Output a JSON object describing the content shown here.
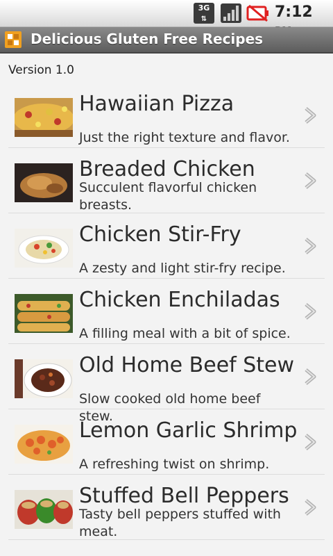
{
  "status": {
    "network": "3G",
    "time": "7:12",
    "ampm": "PM"
  },
  "app": {
    "title": "Delicious Gluten Free Recipes",
    "version": "Version 1.0"
  },
  "recipes": [
    {
      "title": "Hawaiian Pizza",
      "desc": "Just the right texture and flavor.",
      "lines": 1
    },
    {
      "title": "Breaded Chicken",
      "desc": "Succulent flavorful chicken breasts.",
      "lines": 2
    },
    {
      "title": "Chicken Stir-Fry",
      "desc": "A zesty and light stir-fry recipe.",
      "lines": 1
    },
    {
      "title": "Chicken Enchiladas",
      "desc": "A filling meal with a bit of spice.",
      "lines": 1
    },
    {
      "title": "Old Home Beef Stew",
      "desc": "Slow cooked old home beef stew.",
      "lines": 1
    },
    {
      "title": "Lemon Garlic Shrimp",
      "desc": "A refreshing twist on shrimp.",
      "lines": 1
    },
    {
      "title": "Stuffed Bell Peppers",
      "desc": "Tasty bell peppers stuffed with meat.",
      "lines": 2
    }
  ],
  "colors": {
    "background": "#f3f3f3",
    "titlebar": "#6e6e6e",
    "text": "#2b2b2b",
    "battery_alert": "#e02020",
    "app_icon": "#f0a020"
  }
}
